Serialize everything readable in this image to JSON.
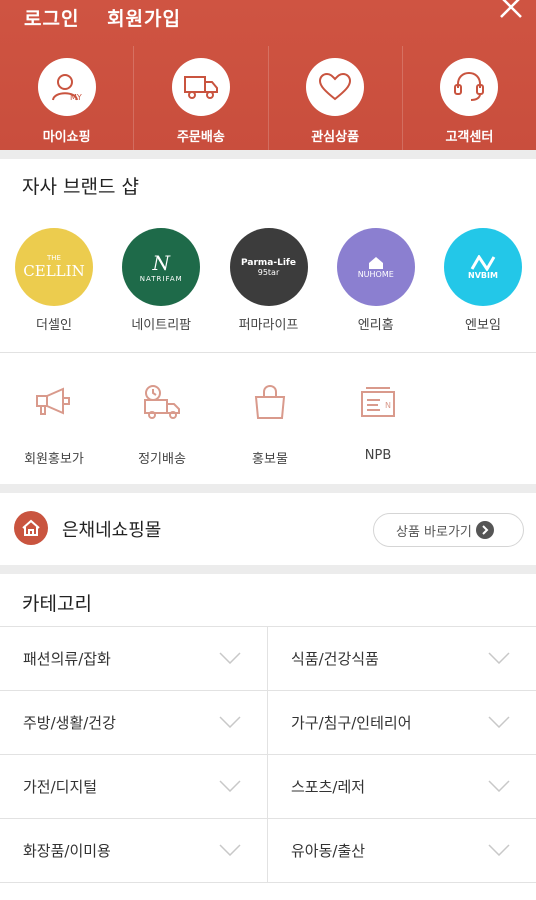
{
  "header": {
    "login_label": "로그인",
    "signup_label": "회원가입",
    "quick_menu": [
      {
        "label": "마이쇼핑",
        "icon": "my-shopping-icon"
      },
      {
        "label": "주문배송",
        "icon": "delivery-truck-icon"
      },
      {
        "label": "관심상품",
        "icon": "heart-icon"
      },
      {
        "label": "고객센터",
        "icon": "headset-icon"
      }
    ]
  },
  "brand_shop": {
    "title": "자사 브랜드 샵",
    "brands": [
      {
        "label": "더셀인",
        "logo_text": "CELLIN",
        "logo_sub": "THE",
        "color": "#eccc4e"
      },
      {
        "label": "네이트리팜",
        "logo_text": "N",
        "logo_sub": "NATRIFAM",
        "color": "#1e6a49"
      },
      {
        "label": "퍼마라이프",
        "logo_text": "Parma-Life",
        "logo_sub": "95tar",
        "color": "#3c3c3c"
      },
      {
        "label": "엔리홈",
        "logo_text": "NUHOME",
        "logo_sub": "",
        "color": "#8b7fd0"
      },
      {
        "label": "엔보임",
        "logo_text": "NVBIM",
        "logo_sub": "",
        "color": "#23c7e8"
      }
    ]
  },
  "services": [
    {
      "label": "회원홍보가",
      "icon": "megaphone-icon"
    },
    {
      "label": "정기배송",
      "icon": "scheduled-delivery-icon"
    },
    {
      "label": "홍보물",
      "icon": "shopping-bag-icon"
    },
    {
      "label": "NPB",
      "icon": "npb-box-icon"
    }
  ],
  "mall": {
    "title": "은채네쇼핑몰",
    "button_label": "상품 바로가기"
  },
  "category": {
    "title": "카테고리",
    "items": [
      [
        "패션의류/잡화",
        "식품/건강식품"
      ],
      [
        "주방/생활/건강",
        "가구/침구/인테리어"
      ],
      [
        "가전/디지털",
        "스포츠/레저"
      ],
      [
        "화장품/이미용",
        "유아동/출산"
      ]
    ]
  },
  "colors": {
    "header": "#cf5442",
    "accent_icon": "#d99a8c"
  }
}
